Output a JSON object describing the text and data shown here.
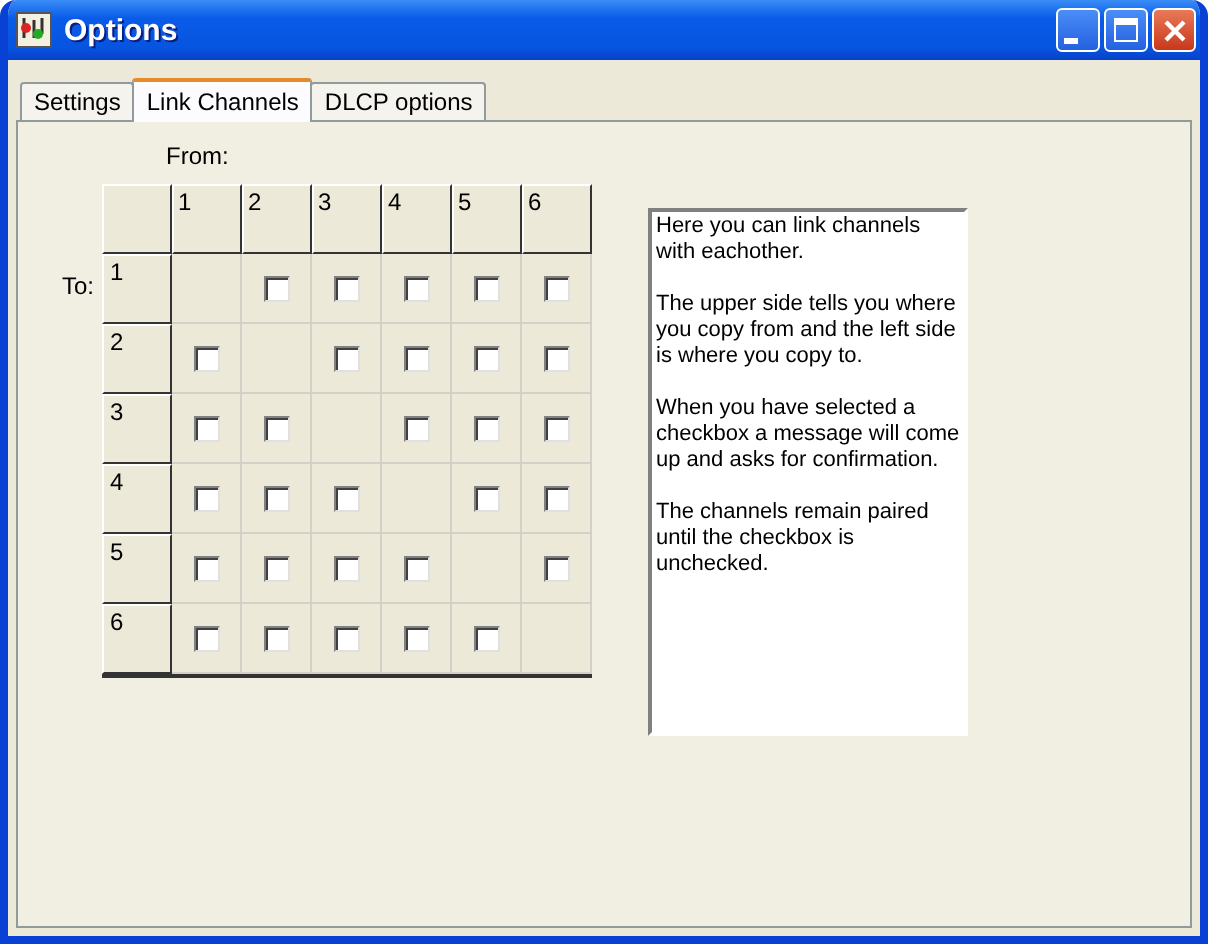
{
  "window": {
    "title": "Options"
  },
  "tabs": [
    {
      "label": "Settings",
      "selected": false
    },
    {
      "label": "Link Channels",
      "selected": true
    },
    {
      "label": "DLCP options",
      "selected": false
    }
  ],
  "from_label": "From:",
  "to_label": "To:",
  "columns": [
    "1",
    "2",
    "3",
    "4",
    "5",
    "6"
  ],
  "rows": [
    {
      "label": "1",
      "cells": [
        {
          "kind": "empty"
        },
        {
          "kind": "checkbox",
          "checked": false
        },
        {
          "kind": "checkbox",
          "checked": false
        },
        {
          "kind": "checkbox",
          "checked": false
        },
        {
          "kind": "checkbox",
          "checked": false
        },
        {
          "kind": "checkbox",
          "checked": false
        }
      ]
    },
    {
      "label": "2",
      "cells": [
        {
          "kind": "checkbox",
          "checked": false
        },
        {
          "kind": "empty"
        },
        {
          "kind": "checkbox",
          "checked": false
        },
        {
          "kind": "checkbox",
          "checked": false
        },
        {
          "kind": "checkbox",
          "checked": false
        },
        {
          "kind": "checkbox",
          "checked": false
        }
      ]
    },
    {
      "label": "3",
      "cells": [
        {
          "kind": "checkbox",
          "checked": false
        },
        {
          "kind": "checkbox",
          "checked": false
        },
        {
          "kind": "empty"
        },
        {
          "kind": "checkbox",
          "checked": false
        },
        {
          "kind": "checkbox",
          "checked": false
        },
        {
          "kind": "checkbox",
          "checked": false
        }
      ]
    },
    {
      "label": "4",
      "cells": [
        {
          "kind": "checkbox",
          "checked": false
        },
        {
          "kind": "checkbox",
          "checked": false
        },
        {
          "kind": "checkbox",
          "checked": false
        },
        {
          "kind": "empty"
        },
        {
          "kind": "checkbox",
          "checked": false
        },
        {
          "kind": "checkbox",
          "checked": false
        }
      ]
    },
    {
      "label": "5",
      "cells": [
        {
          "kind": "checkbox",
          "checked": false
        },
        {
          "kind": "checkbox",
          "checked": false
        },
        {
          "kind": "checkbox",
          "checked": false
        },
        {
          "kind": "checkbox",
          "checked": false
        },
        {
          "kind": "empty"
        },
        {
          "kind": "checkbox",
          "checked": false
        }
      ]
    },
    {
      "label": "6",
      "cells": [
        {
          "kind": "checkbox",
          "checked": false
        },
        {
          "kind": "checkbox",
          "checked": false
        },
        {
          "kind": "checkbox",
          "checked": false
        },
        {
          "kind": "checkbox",
          "checked": false
        },
        {
          "kind": "checkbox",
          "checked": false
        },
        {
          "kind": "empty"
        }
      ]
    }
  ],
  "help_text": [
    "Here you can link channels with eachother.",
    "The upper side tells you where you copy from and the left side is where you copy to.",
    "When you have selected a checkbox a message will come up and asks for confirmation.",
    "The channels remain paired until the checkbox is unchecked."
  ]
}
